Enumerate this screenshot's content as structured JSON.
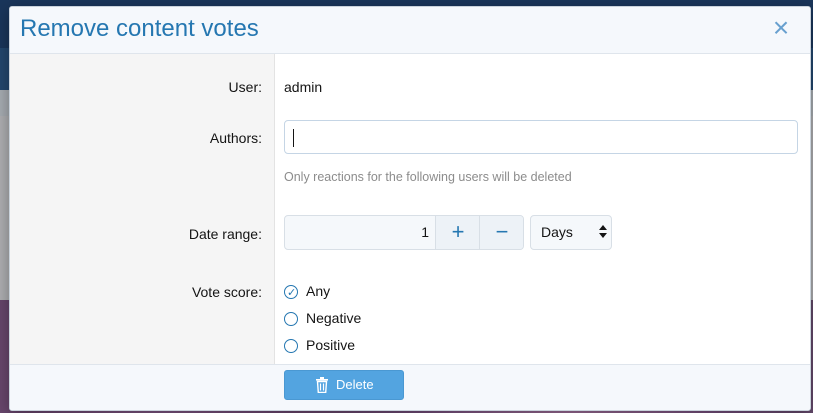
{
  "dialog": {
    "title": "Remove content votes",
    "close_glyph": "×"
  },
  "form": {
    "user": {
      "label": "User:",
      "value": "admin"
    },
    "authors": {
      "label": "Authors:",
      "value": "",
      "hint": "Only reactions for the following users will be deleted"
    },
    "date_range": {
      "label": "Date range:",
      "value": "1",
      "plus": "+",
      "minus": "−",
      "unit": "Days"
    },
    "vote_score": {
      "label": "Vote score:",
      "options": [
        {
          "label": "Any",
          "selected": true
        },
        {
          "label": "Negative",
          "selected": false
        },
        {
          "label": "Positive",
          "selected": false
        }
      ]
    }
  },
  "footer": {
    "delete_label": "Delete",
    "delete_icon": "trash-icon"
  },
  "colors": {
    "accent": "#2577b1",
    "button": "#53a4e0"
  }
}
